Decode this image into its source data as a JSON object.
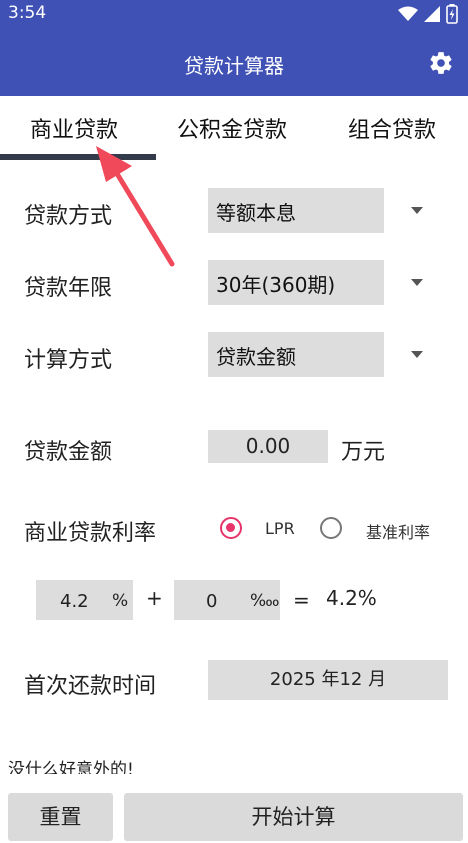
{
  "status_bar": {
    "time": "3:54"
  },
  "app_bar": {
    "title": "贷款计算器",
    "settings_icon": "gear-icon"
  },
  "tabs": [
    {
      "label": "商业贷款",
      "selected": true
    },
    {
      "label": "公积金贷款",
      "selected": false
    },
    {
      "label": "组合贷款",
      "selected": false
    }
  ],
  "form": {
    "loan_method": {
      "label": "贷款方式",
      "value": "等额本息"
    },
    "loan_term": {
      "label": "贷款年限",
      "value": "30年(360期)"
    },
    "calc_method": {
      "label": "计算方式",
      "value": "贷款金额"
    },
    "loan_amount": {
      "label": "贷款金额",
      "value": "0.00",
      "unit": "万元"
    },
    "rate": {
      "label": "商业贷款利率",
      "options": [
        {
          "label": "LPR",
          "checked": true
        },
        {
          "label": "基准利率",
          "checked": false
        }
      ],
      "base_value": "4.2",
      "base_unit": "%",
      "plus": "+",
      "adjust_value": "0",
      "adjust_unit": "‱",
      "equals": "=",
      "result": "4.2%"
    },
    "first_payment": {
      "label": "首次还款时间",
      "value": "2025 年12 月"
    }
  },
  "slogan": "没什么好意外的!",
  "buttons": {
    "reset": "重置",
    "calculate": "开始计算"
  },
  "colors": {
    "primary": "#3f51b5",
    "accent": "#e8336b",
    "annotation_arrow": "#f0495a"
  }
}
